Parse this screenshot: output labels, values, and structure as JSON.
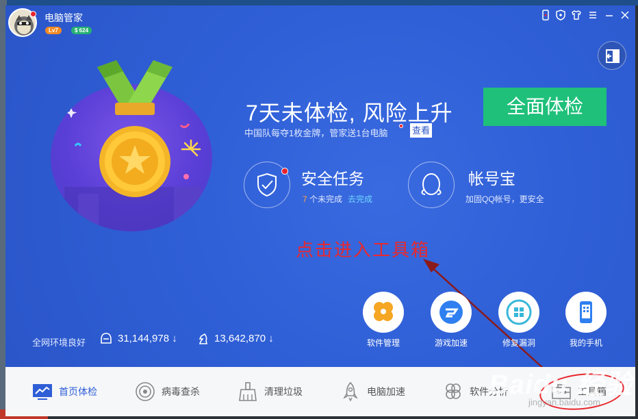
{
  "window": {
    "title": "电脑管家",
    "level_badge": "Lv7",
    "coin_badge": "$ 624"
  },
  "hero": {
    "headline": "7天未体检, 风险上升",
    "subline": "中国队每夺1枚金牌，管家送1台电脑",
    "view_button": "查看",
    "scan_button": "全面体检"
  },
  "security_task": {
    "title": "安全任务",
    "count": "7",
    "status": "个未完成",
    "link": "去完成"
  },
  "account": {
    "title": "帐号宝",
    "subtitle": "加固QQ帐号，更安全"
  },
  "annotation": "点击进入工具箱",
  "tools": [
    {
      "label": "软件管理",
      "icon": "clover-icon"
    },
    {
      "label": "游戏加速",
      "icon": "game-boost-icon"
    },
    {
      "label": "修复漏洞",
      "icon": "windows-repair-icon"
    },
    {
      "label": "我的手机",
      "icon": "phone-icon"
    }
  ],
  "stats": {
    "network_status": "全网环境良好",
    "guarded_count": "31,144,978",
    "chess_count": "13,642,870"
  },
  "bottom_nav": [
    {
      "label": "首页体检",
      "icon": "monitor-icon"
    },
    {
      "label": "病毒查杀",
      "icon": "target-icon"
    },
    {
      "label": "清理垃圾",
      "icon": "broom-icon"
    },
    {
      "label": "电脑加速",
      "icon": "rocket-icon"
    },
    {
      "label": "软件分析",
      "icon": "clover-outline-icon"
    },
    {
      "label": "工具箱",
      "icon": "toolbox-icon"
    }
  ],
  "watermark": {
    "main": "Baidu 经验",
    "sub": "jingyan.baidu.com"
  },
  "colors": {
    "window_blue": "#2f5fd6",
    "scan_green": "#1fc07a",
    "annotation_red": "#e8282d",
    "nav_active": "#2f5fd6"
  }
}
